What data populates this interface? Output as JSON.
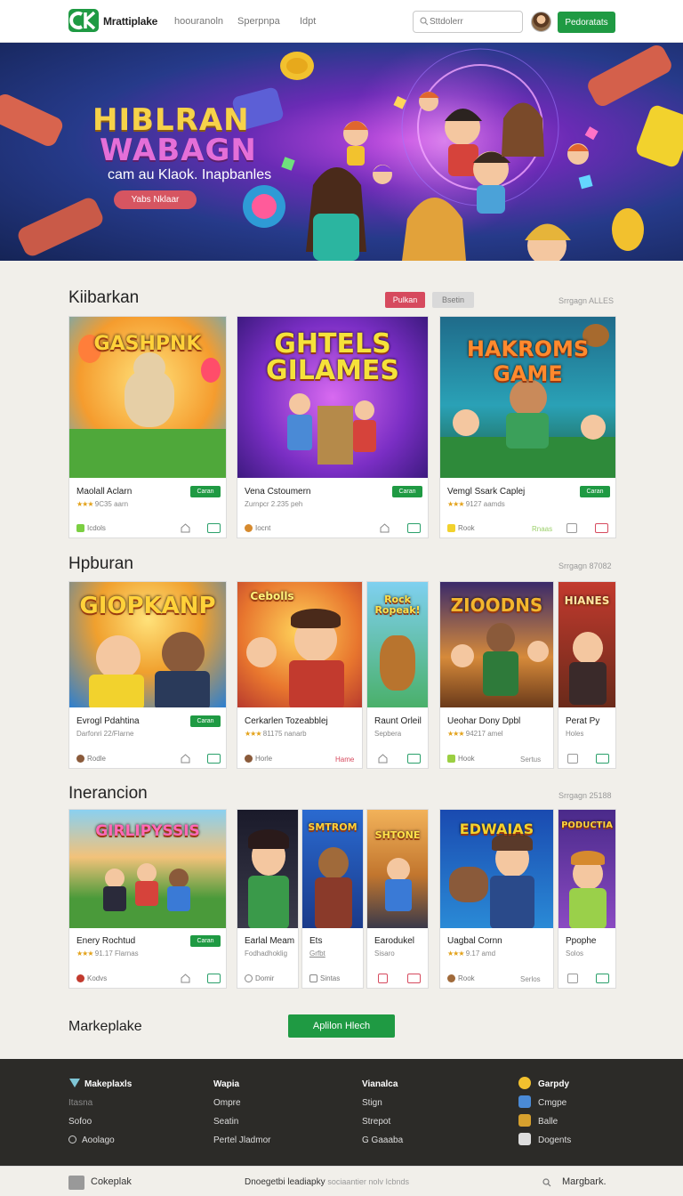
{
  "header": {
    "brand": "Mrattiplake",
    "nav": [
      "hoouranoln",
      "Sperpnpa",
      "Idpt"
    ],
    "search_placeholder": "Sttdolerr",
    "cta_label": "Pedoratats"
  },
  "hero": {
    "title_line1": "HIBLRAN",
    "title_line2": "WABAGN",
    "subtitle": "cam au Klaok. Inapbanles",
    "button": "Yabs Nklaar"
  },
  "section1": {
    "title": "Kiibarkan",
    "tab_active": "Pulkan",
    "tab_inactive": "Bsetin",
    "meta": "Srrgagn ALLES",
    "cards": [
      {
        "art": "GASHPNK",
        "title": "Maolall Aclarn",
        "meta": "9C35 aarn",
        "badge": "Caran",
        "foot": "Icdols",
        "mid": ""
      },
      {
        "art": "GHTELS GILAMES",
        "title": "Vena Cstoumern",
        "meta": "Zurnpcr 2.235 peh",
        "badge": "Caran",
        "foot": "Iocnt",
        "mid": ""
      },
      {
        "art": "HAKROMS GAME",
        "title": "Vemgl Ssark Caplej",
        "meta": "9127 aamds",
        "badge": "Caran",
        "foot": "Rook",
        "mid": "Rnaas"
      }
    ]
  },
  "section2": {
    "title": "Hpburan",
    "meta": "Srrgagn 87082",
    "cards": [
      {
        "art": "GIOPKANP",
        "title": "Evrogl Pdahtina",
        "meta": "Darfonri 22/Flarne",
        "badge": "Caran",
        "foot": "Rodle",
        "mid": ""
      },
      {
        "art": "Cebolls",
        "title": "Cerkarlen Tozeabblej",
        "meta": "81175 nanarb",
        "badge": "",
        "foot": "Horle",
        "mid": "Hame"
      },
      {
        "art": "Rock Ropeak!",
        "title": "Raunt Orleil",
        "meta": "Sepbera",
        "badge": "",
        "foot": "",
        "mid": ""
      },
      {
        "art": "ZIOODNS",
        "title": "Ueohar Dony Dpbl",
        "meta": "94217 amel",
        "badge": "",
        "foot": "Hook",
        "mid": "Sertus"
      },
      {
        "art": "HIANES",
        "title": "Perat Py",
        "meta": "Holes",
        "badge": "",
        "foot": "",
        "mid": ""
      }
    ]
  },
  "section3": {
    "title": "Inerancion",
    "meta": "Srrgagn 25188",
    "cards": [
      {
        "art": "GIRLIPYSSIS",
        "title": "Enery Rochtud",
        "meta": "91.17 Flarnas",
        "badge": "Caran",
        "foot": "Kodvs",
        "mid": ""
      },
      {
        "art": "",
        "title": "Earlal Meam",
        "meta": "Fodhadhoklig",
        "badge": "",
        "foot": "Domir",
        "mid": ""
      },
      {
        "art": "SMTROM",
        "title": "Ets",
        "meta": "Grfbt",
        "badge": "",
        "foot": "Sintas",
        "mid": ""
      },
      {
        "art": "SHTONE",
        "title": "Earodukel",
        "meta": "Sisaro",
        "badge": "",
        "foot": "",
        "mid": ""
      },
      {
        "art": "EDWAIAS",
        "title": "Uagbal Cornn",
        "meta": "9.17 amd",
        "badge": "",
        "foot": "Rook",
        "mid": "Serlos"
      },
      {
        "art": "PODUCTIA",
        "title": "Ppophe",
        "meta": "Solos",
        "badge": "",
        "foot": "",
        "mid": ""
      }
    ]
  },
  "more": {
    "label": "Markeplake",
    "button": "Aplilon Hlech"
  },
  "footer": {
    "col1": {
      "title": "Makeplaxls",
      "items": [
        "Itasna",
        "Sofoo",
        "Aoolago"
      ]
    },
    "col2": {
      "title": "Wapia",
      "items": [
        "Ompre",
        "Seatin",
        "Pertel Jladmor"
      ]
    },
    "col3": {
      "title": "Vianalca",
      "items": [
        "Stign",
        "Strepot",
        "G Gaaaba"
      ]
    },
    "col4": {
      "title": "Garpdy",
      "items": [
        "Cmgpe",
        "Balle",
        "Dogents"
      ]
    }
  },
  "bottom": {
    "brand": "Cokeplak",
    "center": "Dnoegetbi leadiapky",
    "center_tail": "sociaantier nolv Icbnds",
    "right": "Margbark."
  },
  "colors": {
    "accent": "#1f9a43",
    "hero_btn": "#d65561",
    "footer": "#2c2b28",
    "star": "#e3a21a"
  },
  "icons": [
    "logo-icon",
    "search-icon",
    "home-icon",
    "box-icon",
    "star-icon",
    "shield-icon",
    "sparkle-icon"
  ]
}
